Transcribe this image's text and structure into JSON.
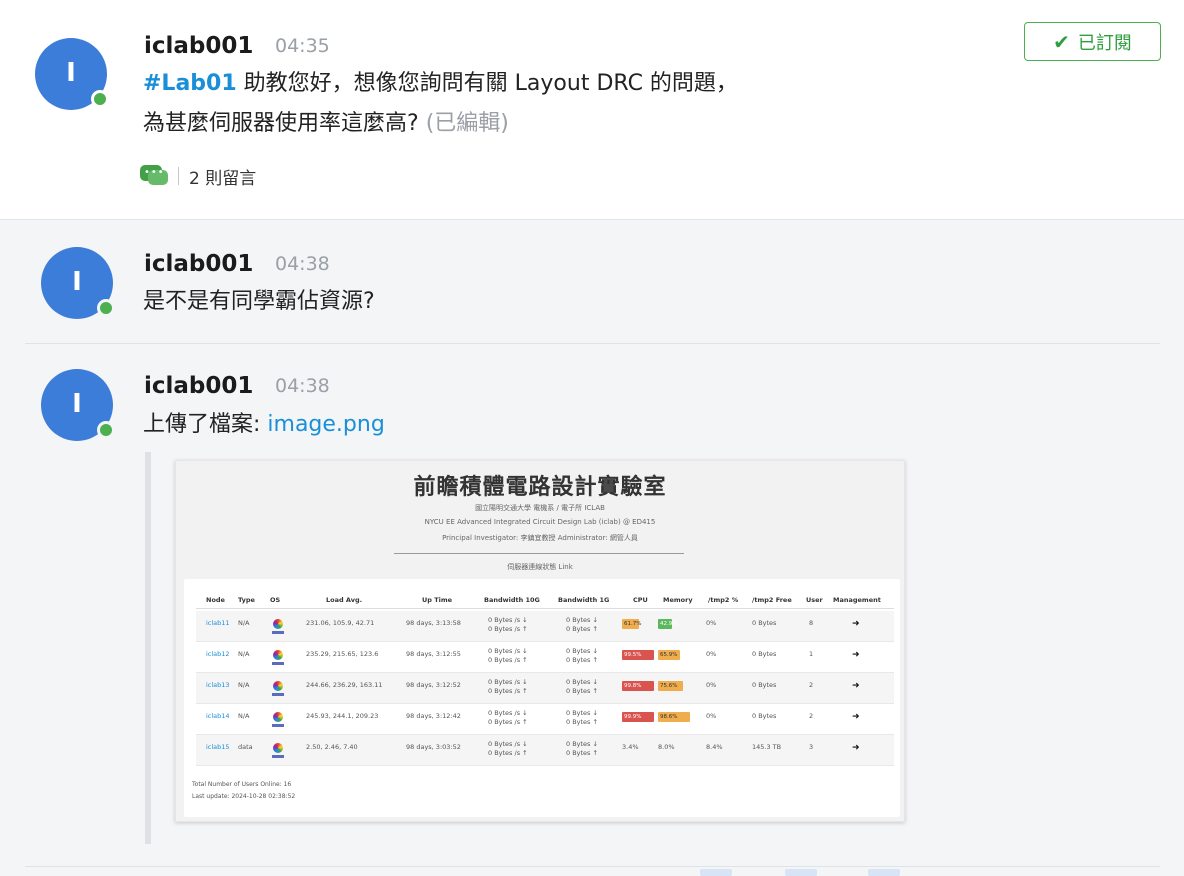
{
  "post": {
    "avatar_letter": "I",
    "author": "iclab001",
    "time": "04:35",
    "hashtag": "#Lab01",
    "line1": " 助教您好，想像您詢問有關 Layout DRC 的問題，",
    "line2": "為甚麼伺服器使用率這麼高?",
    "edited": "(已編輯)",
    "comment_count": "2 則留言",
    "subscribe_label": "已訂閱",
    "colors": {
      "link": "#1a8fd8",
      "online": "#4caf50",
      "avatar": "#3b7dd8",
      "subscribed": "#2e9e3e"
    }
  },
  "replies": [
    {
      "avatar_letter": "I",
      "author": "iclab001",
      "time": "04:38",
      "text": "是不是有同學霸佔資源?"
    },
    {
      "avatar_letter": "I",
      "author": "iclab001",
      "time": "04:38",
      "text": "上傳了檔案: ",
      "file_name": "image.png"
    }
  ],
  "embedded_image": {
    "title": "前瞻積體電路設計實驗室",
    "sub1": "國立陽明交通大學 電機系 / 電子所 ICLAB",
    "sub2": "NYCU EE Advanced Integrated Circuit Design Lab (iclab) @ ED415",
    "sub3": "Principal Investigator: 李鎮宜教授 Administrator: 網管人員",
    "sub4": "伺服器連線狀態 Link",
    "headers": [
      "Node",
      "Type",
      "OS",
      "Load Avg.",
      "Up Time",
      "Bandwidth 10G",
      "Bandwidth 1G",
      "CPU",
      "Memory",
      "/tmp2 %",
      "/tmp2 Free",
      "User",
      "Management"
    ],
    "rows": [
      {
        "node": "iclab11",
        "type": "N/A",
        "load": "231.06, 105.9, 42.71",
        "uptime": "98 days, 3:13:58",
        "bw10": "0 Bytes /s ↓|0 Bytes /s ↑",
        "bw1": "0 Bytes ↓|0 Bytes ↑",
        "cpu": "61.7%",
        "cpu_level": "orange",
        "cpu_pct": 0.32,
        "mem": "42.9%",
        "mem_level": "green",
        "mem_pct": 0.26,
        "tmp": "0%",
        "free": "0 Bytes",
        "user": "8"
      },
      {
        "node": "iclab12",
        "type": "N/A",
        "load": "235.29, 215.65, 123.6",
        "uptime": "98 days, 3:12:55",
        "bw10": "0 Bytes /s ↓|0 Bytes /s ↑",
        "bw1": "0 Bytes ↓|0 Bytes ↑",
        "cpu": "99.5%",
        "cpu_level": "red",
        "cpu_pct": 0.62,
        "mem": "65.9%",
        "mem_level": "orange",
        "mem_pct": 0.42,
        "tmp": "0%",
        "free": "0 Bytes",
        "user": "1"
      },
      {
        "node": "iclab13",
        "type": "N/A",
        "load": "244.66, 236.29, 163.11",
        "uptime": "98 days, 3:12:52",
        "bw10": "0 Bytes /s ↓|0 Bytes /s ↑",
        "bw1": "0 Bytes ↓|0 Bytes ↑",
        "cpu": "99.8%",
        "cpu_level": "red",
        "cpu_pct": 0.62,
        "mem": "75.6%",
        "mem_level": "orange",
        "mem_pct": 0.48,
        "tmp": "0%",
        "free": "0 Bytes",
        "user": "2"
      },
      {
        "node": "iclab14",
        "type": "N/A",
        "load": "245.93, 244.1, 209.23",
        "uptime": "98 days, 3:12:42",
        "bw10": "0 Bytes /s ↓|0 Bytes /s ↑",
        "bw1": "0 Bytes ↓|0 Bytes ↑",
        "cpu": "99.9%",
        "cpu_level": "red",
        "cpu_pct": 0.62,
        "mem": "98.6%",
        "mem_level": "orange",
        "mem_pct": 0.62,
        "tmp": "0%",
        "free": "0 Bytes",
        "user": "2"
      },
      {
        "node": "iclab15",
        "type": "data",
        "load": "2.50, 2.46, 7.40",
        "uptime": "98 days, 3:03:52",
        "bw10": "0 Bytes /s ↓|0 Bytes /s ↑",
        "bw1": "0 Bytes ↓|0 Bytes ↑",
        "cpu": "3.4%",
        "cpu_level": "none",
        "cpu_pct": 0,
        "mem": "8.0%",
        "mem_level": "none",
        "mem_pct": 0,
        "tmp": "8.4%",
        "free": "145.3 TB",
        "user": "3"
      }
    ],
    "footer1": "Total Number of Users Online:   16",
    "footer2": "Last update:   2024-10-28 02:38:52"
  }
}
